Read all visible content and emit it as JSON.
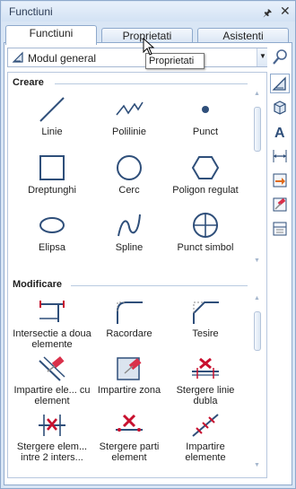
{
  "window": {
    "title": "Functiuni"
  },
  "tabs": [
    {
      "label": "Functiuni",
      "active": true
    },
    {
      "label": "Proprietati",
      "active": false
    },
    {
      "label": "Asistenti",
      "active": false
    }
  ],
  "module_select": {
    "value": "Modul general"
  },
  "tooltip": {
    "text": "Proprietati"
  },
  "sections": [
    {
      "title": "Creare",
      "tools": [
        {
          "icon": "line-icon",
          "label": "Linie"
        },
        {
          "icon": "polyline-icon",
          "label": "Polilinie"
        },
        {
          "icon": "point-icon",
          "label": "Punct"
        },
        {
          "icon": "rectangle-icon",
          "label": "Dreptunghi"
        },
        {
          "icon": "circle-icon",
          "label": "Cerc"
        },
        {
          "icon": "hexagon-icon",
          "label": "Poligon regulat"
        },
        {
          "icon": "ellipse-icon",
          "label": "Elipsa"
        },
        {
          "icon": "spline-icon",
          "label": "Spline"
        },
        {
          "icon": "symbol-point-icon",
          "label": "Punct simbol"
        }
      ]
    },
    {
      "title": "Modificare",
      "tools": [
        {
          "icon": "intersect-icon",
          "label": "Intersectie a doua elemente"
        },
        {
          "icon": "fillet-icon",
          "label": "Racordare"
        },
        {
          "icon": "chamfer-icon",
          "label": "Tesire"
        },
        {
          "icon": "split-by-element-icon",
          "label": "Impartire ele... cu element"
        },
        {
          "icon": "split-zone-icon",
          "label": "Impartire zona"
        },
        {
          "icon": "delete-double-line-icon",
          "label": "Stergere linie dubla"
        },
        {
          "icon": "delete-between-icon",
          "label": "Stergere elem... intre 2 inters..."
        },
        {
          "icon": "delete-parts-icon",
          "label": "Stergere parti element"
        },
        {
          "icon": "split-elements-icon",
          "label": "Impartire elemente"
        }
      ]
    }
  ],
  "sidebar": [
    {
      "icon": "drafting-icon"
    },
    {
      "icon": "3d-modeling-icon"
    },
    {
      "icon": "text-icon"
    },
    {
      "icon": "dimension-icon"
    },
    {
      "icon": "transform-icon"
    },
    {
      "icon": "edit-icon"
    },
    {
      "icon": "layout-icon"
    }
  ]
}
